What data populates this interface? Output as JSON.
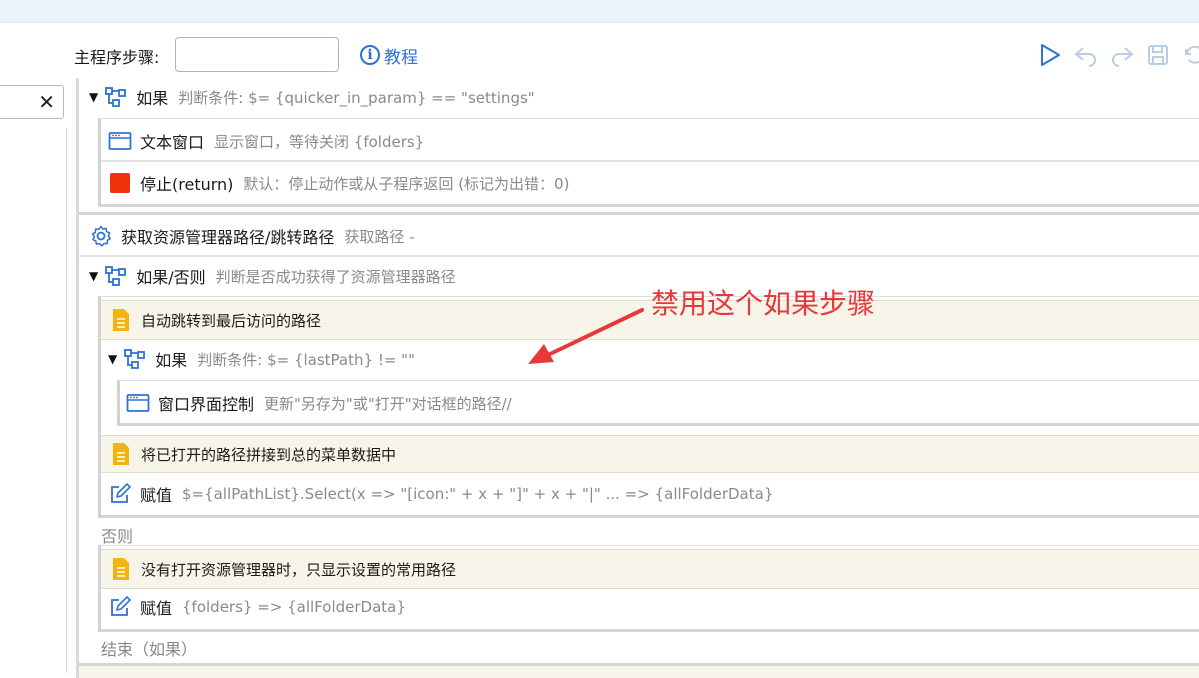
{
  "header": {
    "main_steps_label": "主程序步骤:",
    "tutorial_label": "教程"
  },
  "left_search": {
    "clear_glyph": "✕"
  },
  "steps": {
    "if1": {
      "title": "如果",
      "desc": "判断条件:  $= {quicker_in_param} == \"settings\""
    },
    "textwin": {
      "title": "文本窗口",
      "desc": "显示窗口，等待关闭 {folders}"
    },
    "stop": {
      "title": "停止(return)",
      "desc": "默认：停止动作或从子程序返回 (标记为出错：0)"
    },
    "getpath": {
      "title": "获取资源管理器路径/跳转路径",
      "desc": "获取路径 -"
    },
    "ifelse": {
      "title": "如果/否则",
      "desc": "判断是否成功获得了资源管理器路径"
    },
    "note1": {
      "title": "自动跳转到最后访问的路径"
    },
    "if2": {
      "title": "如果",
      "desc": "判断条件:  $= {lastPath} != \"\""
    },
    "winctrl": {
      "title": "窗口界面控制",
      "desc": "更新\"另存为\"或\"打开\"对话框的路径//"
    },
    "note2": {
      "title": "将已打开的路径拼接到总的菜单数据中"
    },
    "assign1": {
      "title": "赋值",
      "desc": "$={allPathList}.Select(x => \"[icon:\" + x + \"]\" + x + \"|\" ... => {allFolderData}"
    },
    "else_label": "否则",
    "note3": {
      "title": "没有打开资源管理器时，只显示设置的常用路径"
    },
    "assign2": {
      "title": "赋值",
      "desc": "{folders} => {allFolderData}"
    },
    "end_label": "结束（如果）"
  },
  "annotation": {
    "text": "禁用这个如果步骤"
  },
  "colors": {
    "accent": "#2e72d2",
    "annotation": "#e8393a",
    "stop": "#f0320a",
    "note": "#f2b50e"
  }
}
